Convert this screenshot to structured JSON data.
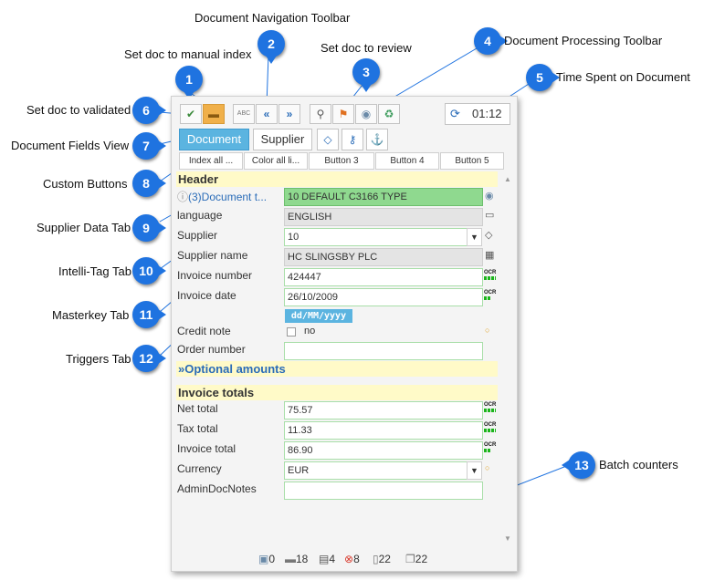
{
  "callouts": [
    {
      "num": "1",
      "text": ""
    },
    {
      "num": "2",
      "text": "Document Navigation Toolbar"
    },
    {
      "num": "",
      "text": "Set doc to manual index"
    },
    {
      "num": "3",
      "text": "Set doc to review"
    },
    {
      "num": "4",
      "text": "Document Processing Toolbar"
    },
    {
      "num": "5",
      "text": "Time Spent on Document"
    },
    {
      "num": "6",
      "text": "Set doc to validated"
    },
    {
      "num": "7",
      "text": "Document Fields View"
    },
    {
      "num": "8",
      "text": "Custom Buttons"
    },
    {
      "num": "9",
      "text": "Supplier Data Tab"
    },
    {
      "num": "10",
      "text": "Intelli-Tag Tab"
    },
    {
      "num": "11",
      "text": "Masterkey Tab"
    },
    {
      "num": "12",
      "text": "Triggers Tab"
    },
    {
      "num": "13",
      "text": "Batch counters"
    }
  ],
  "toolbar": {
    "validate_icon": "double-check-icon",
    "manual_index_icon": "stamp-icon",
    "abc_label": "ABC",
    "prev_icon": "double-chevron-left-icon",
    "next_icon": "double-chevron-right-icon",
    "search_icon": "magnifier-icon",
    "review_icon": "flag-icon",
    "view_icon": "eye-icon",
    "recycle_icon": "recycle-icon",
    "timer_value": "01:12"
  },
  "tabs": {
    "document": "Document",
    "supplier": "Supplier"
  },
  "custom_buttons": [
    "Index all ...",
    "Color all li...",
    "Button 3",
    "Button 4",
    "Button 5"
  ],
  "sections": {
    "header": "Header",
    "optional": "Optional amounts",
    "totals": "Invoice totals"
  },
  "fields": {
    "doc_type_label": "(3)Document t...",
    "doc_type_value": "10 DEFAULT C3166 TYPE",
    "language_label": "language",
    "language_value": "ENGLISH",
    "supplier_label": "Supplier",
    "supplier_value": "10",
    "supplier_name_label": "Supplier name",
    "supplier_name_value": "HC SLINGSBY PLC",
    "invoice_number_label": "Invoice number",
    "invoice_number_value": "424447",
    "invoice_date_label": "Invoice date",
    "invoice_date_value": "26/10/2009",
    "date_format": "dd/MM/yyyy",
    "credit_note_label": "Credit note",
    "credit_note_value": "no",
    "order_number_label": "Order number",
    "order_number_value": "",
    "net_total_label": "Net total",
    "net_total_value": "75.57",
    "tax_total_label": "Tax total",
    "tax_total_value": "11.33",
    "invoice_total_label": "Invoice total",
    "invoice_total_value": "86.90",
    "currency_label": "Currency",
    "currency_value": "EUR",
    "admin_notes_label": "AdminDocNotes",
    "admin_notes_value": ""
  },
  "ocr_label": "OCR",
  "counters": [
    {
      "icon": "scan-icon",
      "value": "0"
    },
    {
      "icon": "stamp-icon",
      "value": "18"
    },
    {
      "icon": "grid-doc-icon",
      "value": "4"
    },
    {
      "icon": "error-icon",
      "value": "8"
    },
    {
      "icon": "page-icon",
      "value": "22"
    },
    {
      "icon": "pages-icon",
      "value": "22"
    }
  ],
  "colors": {
    "badge": "#1f73e0",
    "active_tab": "#5bb4e0",
    "section": "#fffac8",
    "ocr_green": "#1bb51b"
  }
}
